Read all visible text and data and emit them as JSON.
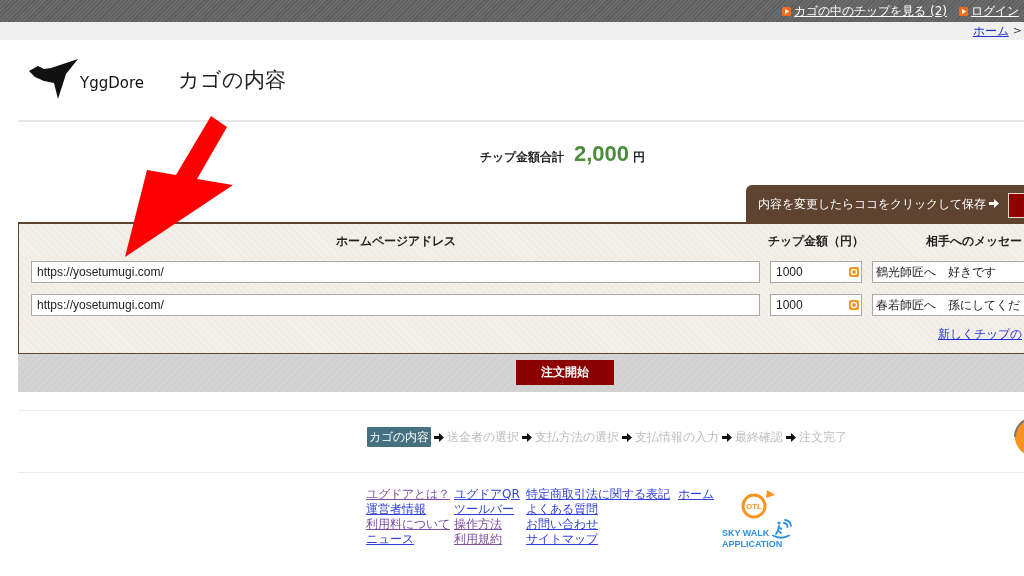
{
  "top_bar": {
    "links": [
      {
        "label": "カゴの中のチップを見る (2)"
      },
      {
        "label": "ログイン"
      }
    ]
  },
  "breadcrumb": [
    {
      "kind": "link",
      "label": "ホーム"
    },
    {
      "kind": "separator",
      "label": ">"
    }
  ],
  "header": {
    "logo": "YggDore",
    "title": "カゴの内容"
  },
  "total": {
    "label": "チップ金額合計",
    "amount": "2,000",
    "unit": "円"
  },
  "save_bar": {
    "text": "内容を変更したらココをクリックして保存"
  },
  "cart_table": {
    "columns": [
      "ホームページアドレス",
      "チップ金額（円）",
      "相手へのメッセー"
    ],
    "rows": [
      {
        "address": "https://yosetumugi.com/",
        "amount": "1000",
        "message": "鶴光師匠へ　好きです"
      },
      {
        "address": "https://yosetumugi.com/",
        "amount": "1000",
        "message": "春若師匠へ　孫にしてくだ"
      }
    ],
    "add_link": "新しくチップの"
  },
  "order_button": "注文開始",
  "steps": [
    {
      "label": "カゴの内容",
      "selected": true
    },
    {
      "label": "送金者の選択",
      "selected": false
    },
    {
      "label": "支払方法の選択",
      "selected": false
    },
    {
      "label": "支払情報の入力",
      "selected": false
    },
    {
      "label": "最終確認",
      "selected": false
    },
    {
      "label": "注文完了",
      "selected": false
    }
  ],
  "footer": {
    "columns": [
      [
        {
          "label": "ユグドアとは？",
          "visited": true
        },
        {
          "label": "運営者情報",
          "visited": false
        },
        {
          "label": "利用料について",
          "visited": true
        },
        {
          "label": "ニュース",
          "visited": false
        }
      ],
      [
        {
          "label": "ユグドアQR",
          "visited": false
        },
        {
          "label": "ツールバー",
          "visited": false
        },
        {
          "label": "操作方法",
          "visited": true
        },
        {
          "label": "利用規約",
          "visited": true
        }
      ],
      [
        {
          "label": "特定商取引法に関する表記",
          "visited": false
        },
        {
          "label": "よくある質問",
          "visited": false
        },
        {
          "label": "お問い合わせ",
          "visited": false
        },
        {
          "label": "サイトマップ",
          "visited": false
        }
      ],
      [
        {
          "label": "ホーム",
          "visited": false
        }
      ]
    ],
    "app_logo": {
      "mark": "OTL",
      "lines": [
        "SKY WALK",
        "APPLICATION"
      ]
    }
  },
  "annotation": {
    "kind": "arrow"
  }
}
